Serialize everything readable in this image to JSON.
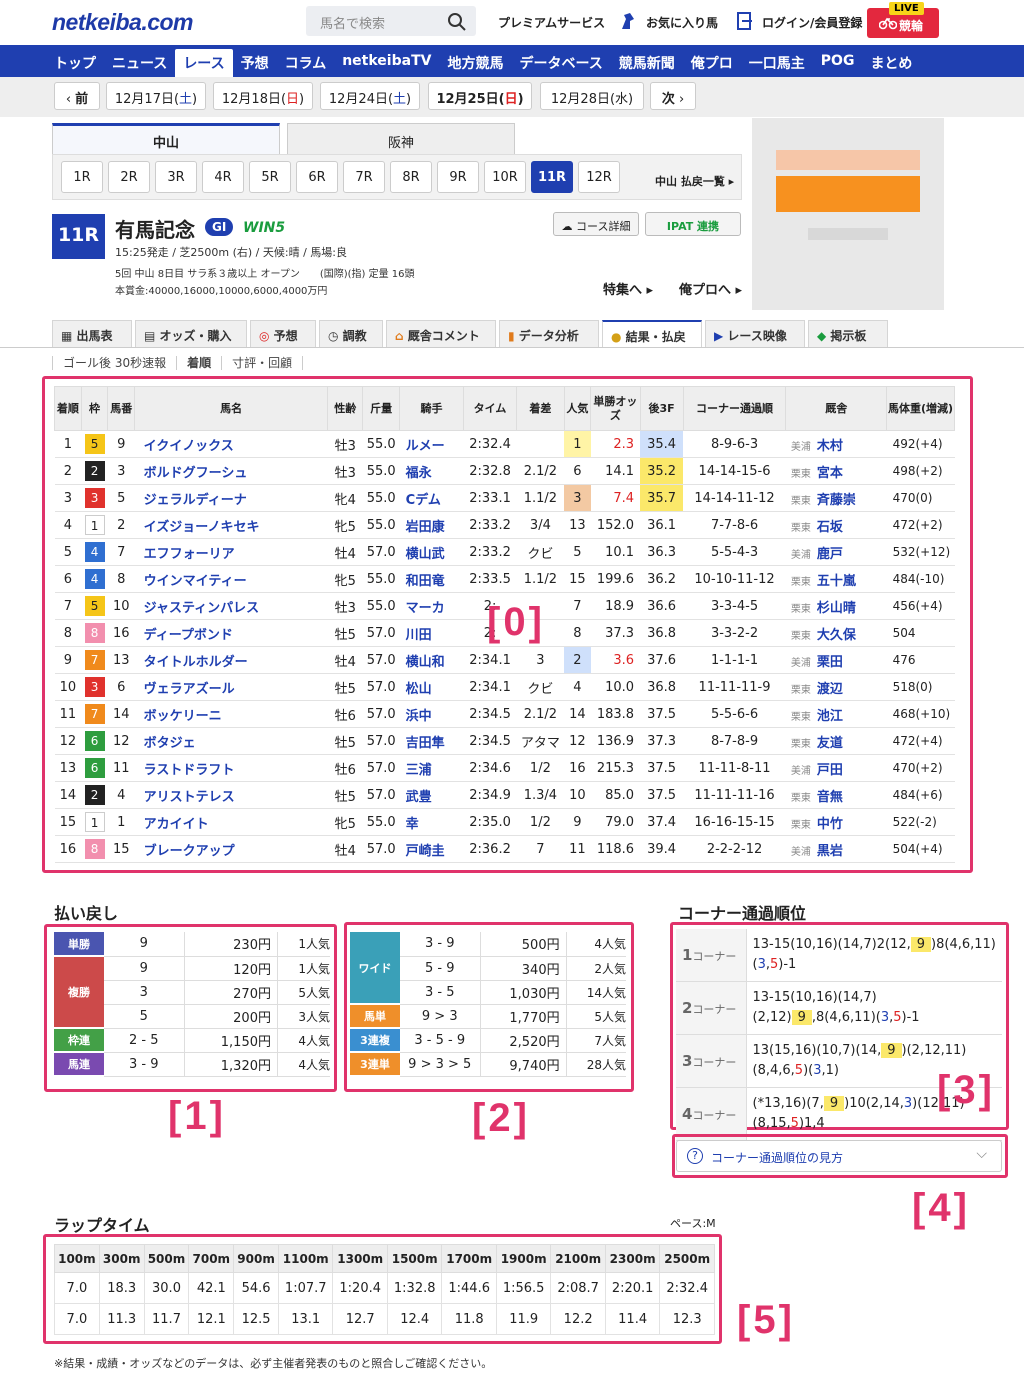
{
  "header": {
    "logo": "netkeiba.com",
    "search_placeholder": "馬名で検索",
    "links": [
      "プレミアムサービス",
      "お気に入り馬",
      "ログイン/会員登録"
    ],
    "live_badge": "LIVE",
    "live_label": "競輪"
  },
  "nav": [
    "トップ",
    "ニュース",
    "レース",
    "予想",
    "コラム",
    "netkeibaTV",
    "地方競馬",
    "データベース",
    "競馬新聞",
    "俺プロ",
    "一口馬主",
    "POG",
    "まとめ"
  ],
  "dates": {
    "prev": "前",
    "next": "次",
    "items": [
      "12月17日(土)",
      "12月18日(日)",
      "12月24日(土)",
      "12月25日(日)",
      "12月28日(水)"
    ]
  },
  "tracks": [
    "中山",
    "阪神"
  ],
  "races": [
    "1R",
    "2R",
    "3R",
    "4R",
    "5R",
    "6R",
    "7R",
    "8R",
    "9R",
    "10R",
    "11R",
    "12R"
  ],
  "payout_list_link": "中山 払戻一覧",
  "race": {
    "num": "11R",
    "name": "有馬記念",
    "grade": "GI",
    "win5": "WIN5",
    "line1": "15:25発走 / 芝2500m (右) / 天候:晴 / 馬場:良",
    "line2": "5回 中山 8日目 サラ系３歳以上 オープン　　(国際)(指) 定量 16頭",
    "line3": "本賞金:40000,16000,10000,6000,4000万円",
    "course_btn": "コース詳細",
    "ipat_btn": "IPAT 連携",
    "tokushu": "特集へ",
    "orepro": "俺プロへ"
  },
  "tabs": [
    "出馬表",
    "オッズ・購入",
    "予想",
    "調教",
    "厩舎コメント",
    "データ分析",
    "結果・払戻",
    "レース映像",
    "掲示板"
  ],
  "subtabs": [
    "ゴール後 30秒速報",
    "着順",
    "寸評・回顧"
  ],
  "result_headers": [
    "着順",
    "枠",
    "馬番",
    "馬名",
    "性齢",
    "斤量",
    "騎手",
    "タイム",
    "着差",
    "人気",
    "単勝オッズ",
    "後3F",
    "コーナー通過順",
    "厩舎",
    "馬体重(増減)"
  ],
  "results": [
    [
      "1",
      "5",
      "9",
      "イクイノックス",
      "牡3",
      "55.0",
      "ルメー",
      "2:32.4",
      "",
      "1",
      "2.3",
      "35.4",
      "8-9-6-3",
      "美浦",
      "木村",
      "492(+4)"
    ],
    [
      "2",
      "2",
      "3",
      "ボルドグフーシュ",
      "牡3",
      "55.0",
      "福永",
      "2:32.8",
      "2.1/2",
      "6",
      "14.1",
      "35.2",
      "14-14-15-6",
      "栗東",
      "宮本",
      "498(+2)"
    ],
    [
      "3",
      "3",
      "5",
      "ジェラルディーナ",
      "牝4",
      "55.0",
      "Cデム",
      "2:33.1",
      "1.1/2",
      "3",
      "7.4",
      "35.7",
      "14-14-11-12",
      "栗東",
      "斉藤崇",
      "470(0)"
    ],
    [
      "4",
      "1",
      "2",
      "イズジョーノキセキ",
      "牝5",
      "55.0",
      "岩田康",
      "2:33.2",
      "3/4",
      "13",
      "152.0",
      "36.1",
      "7-7-8-6",
      "栗東",
      "石坂",
      "472(+2)"
    ],
    [
      "5",
      "4",
      "7",
      "エフフォーリア",
      "牡4",
      "57.0",
      "横山武",
      "2:33.2",
      "クビ",
      "5",
      "10.1",
      "36.3",
      "5-5-4-3",
      "美浦",
      "鹿戸",
      "532(+12)"
    ],
    [
      "6",
      "4",
      "8",
      "ウインマイティー",
      "牝5",
      "55.0",
      "和田竜",
      "2:33.5",
      "1.1/2",
      "15",
      "199.6",
      "36.2",
      "10-10-11-12",
      "栗東",
      "五十嵐",
      "484(-10)"
    ],
    [
      "7",
      "5",
      "10",
      "ジャスティンパレス",
      "牡3",
      "55.0",
      "マーカ",
      "2:",
      "",
      "7",
      "18.9",
      "36.6",
      "3-3-4-5",
      "栗東",
      "杉山晴",
      "456(+4)"
    ],
    [
      "8",
      "8",
      "16",
      "ディープボンド",
      "牡5",
      "57.0",
      "川田",
      "2:",
      "",
      "8",
      "37.3",
      "36.8",
      "3-3-2-2",
      "栗東",
      "大久保",
      "504"
    ],
    [
      "9",
      "7",
      "13",
      "タイトルホルダー",
      "牡4",
      "57.0",
      "横山和",
      "2:34.1",
      "3",
      "2",
      "3.6",
      "37.6",
      "1-1-1-1",
      "美浦",
      "栗田",
      "476"
    ],
    [
      "10",
      "3",
      "6",
      "ヴェラアズール",
      "牡5",
      "57.0",
      "松山",
      "2:34.1",
      "クビ",
      "4",
      "10.0",
      "36.8",
      "11-11-11-9",
      "栗東",
      "渡辺",
      "518(0)"
    ],
    [
      "11",
      "7",
      "14",
      "ボッケリーニ",
      "牡6",
      "57.0",
      "浜中",
      "2:34.5",
      "2.1/2",
      "14",
      "183.8",
      "37.5",
      "5-5-6-6",
      "栗東",
      "池江",
      "468(+10)"
    ],
    [
      "12",
      "6",
      "12",
      "ボタジェ",
      "牡5",
      "57.0",
      "吉田隼",
      "2:34.5",
      "アタマ",
      "12",
      "136.9",
      "37.3",
      "8-7-8-9",
      "栗東",
      "友道",
      "472(+4)"
    ],
    [
      "13",
      "6",
      "11",
      "ラストドラフト",
      "牡6",
      "57.0",
      "三浦",
      "2:34.6",
      "1/2",
      "16",
      "215.3",
      "37.5",
      "11-11-8-11",
      "美浦",
      "戸田",
      "470(+2)"
    ],
    [
      "14",
      "2",
      "4",
      "アリストテレス",
      "牡5",
      "57.0",
      "武豊",
      "2:34.9",
      "1.3/4",
      "10",
      "85.0",
      "37.5",
      "11-11-11-16",
      "栗東",
      "音無",
      "484(+6)"
    ],
    [
      "15",
      "1",
      "1",
      "アカイイト",
      "牝5",
      "55.0",
      "幸",
      "2:35.0",
      "1/2",
      "9",
      "79.0",
      "37.4",
      "16-16-15-15",
      "栗東",
      "中竹",
      "522(-2)"
    ],
    [
      "16",
      "8",
      "15",
      "ブレークアップ",
      "牡4",
      "57.0",
      "戸崎圭",
      "2:36.2",
      "7",
      "11",
      "118.6",
      "39.4",
      "2-2-2-12",
      "美浦",
      "黒岩",
      "504(+4)"
    ]
  ],
  "payout_title": "払い戻し",
  "payout1": [
    {
      "cat": "単勝",
      "color": "#4a55b0",
      "rows": [
        [
          "9",
          "230円",
          "1人気"
        ]
      ]
    },
    {
      "cat": "複勝",
      "color": "#cc4a4a",
      "rows": [
        [
          "9",
          "120円",
          "1人気"
        ],
        [
          "3",
          "270円",
          "5人気"
        ],
        [
          "5",
          "200円",
          "3人気"
        ]
      ]
    },
    {
      "cat": "枠連",
      "color": "#43a047",
      "rows": [
        [
          "2 - 5",
          "1,150円",
          "4人気"
        ]
      ]
    },
    {
      "cat": "馬連",
      "color": "#7a4ab0",
      "rows": [
        [
          "3 - 9",
          "1,320円",
          "4人気"
        ]
      ]
    }
  ],
  "payout2": [
    {
      "cat": "ワイド",
      "color": "#3aa0b8",
      "rows": [
        [
          "3 - 9",
          "500円",
          "4人気"
        ],
        [
          "5 - 9",
          "340円",
          "2人気"
        ],
        [
          "3 - 5",
          "1,030円",
          "14人気"
        ]
      ]
    },
    {
      "cat": "馬単",
      "color": "#ef8f2a",
      "rows": [
        [
          "9 > 3",
          "1,770円",
          "5人気"
        ]
      ]
    },
    {
      "cat": "3連複",
      "color": "#3a8fd0",
      "rows": [
        [
          "3 - 5 - 9",
          "2,520円",
          "7人気"
        ]
      ]
    },
    {
      "cat": "3連単",
      "color": "#ef8f2a",
      "rows": [
        [
          "9 > 3 > 5",
          "9,740円",
          "28人気"
        ]
      ]
    }
  ],
  "corner_title": "コーナー通過順位",
  "corners": [
    {
      "label": "1",
      "suffix": "コーナー",
      "html": "13-15(10,16)(14,7)2(12,<span class='hl'>9</span>)8(4,6,11)(<span class='blu'>3</span>,<span class='red'>5</span>)-1"
    },
    {
      "label": "2",
      "suffix": "コーナー",
      "html": "13-15(10,16)(14,7)(2,12)<span class='hl'>9</span>,8(4,6,11)(<span class='blu'>3</span>,<span class='red'>5</span>)-1"
    },
    {
      "label": "3",
      "suffix": "コーナー",
      "html": "13(15,16)(10,7)(14,<span class='hl'>9</span>)(2,12,11)(8,4,6,<span class='red'>5</span>)(<span class='blu'>3</span>,1)"
    },
    {
      "label": "4",
      "suffix": "コーナー",
      "html": "(*13,16)(7,<span class='hl'>9</span>)10(2,14,<span class='blu'>3</span>)(12,11)(8,15,<span class='red'>5</span>)1,4"
    }
  ],
  "corner_help": "コーナー通過順位の見方",
  "lap_title": "ラップタイム",
  "pace": "ペース:M",
  "lap_headers": [
    "100m",
    "300m",
    "500m",
    "700m",
    "900m",
    "1100m",
    "1300m",
    "1500m",
    "1700m",
    "1900m",
    "2100m",
    "2300m",
    "2500m"
  ],
  "lap_cum": [
    "7.0",
    "18.3",
    "30.0",
    "42.1",
    "54.6",
    "1:07.7",
    "1:20.4",
    "1:32.8",
    "1:44.6",
    "1:56.5",
    "2:08.7",
    "2:20.1",
    "2:32.4"
  ],
  "lap_split": [
    "7.0",
    "11.3",
    "11.7",
    "12.1",
    "12.5",
    "13.1",
    "12.7",
    "12.4",
    "11.8",
    "11.9",
    "12.2",
    "11.4",
    "12.3"
  ],
  "footnote": "※結果・成績・オッズなどのデータは、必ず主催者発表のものと照合しご確認ください。",
  "labels": [
    "[0]",
    "[1]",
    "[2]",
    "[3]",
    "[4]",
    "[5]"
  ],
  "frame_colors": {
    "1": "#ffffff",
    "2": "#222222",
    "3": "#e0322d",
    "4": "#2f6fd1",
    "5": "#f5c518",
    "6": "#2e9d3e",
    "7": "#f08a1c",
    "8": "#f28fae"
  }
}
